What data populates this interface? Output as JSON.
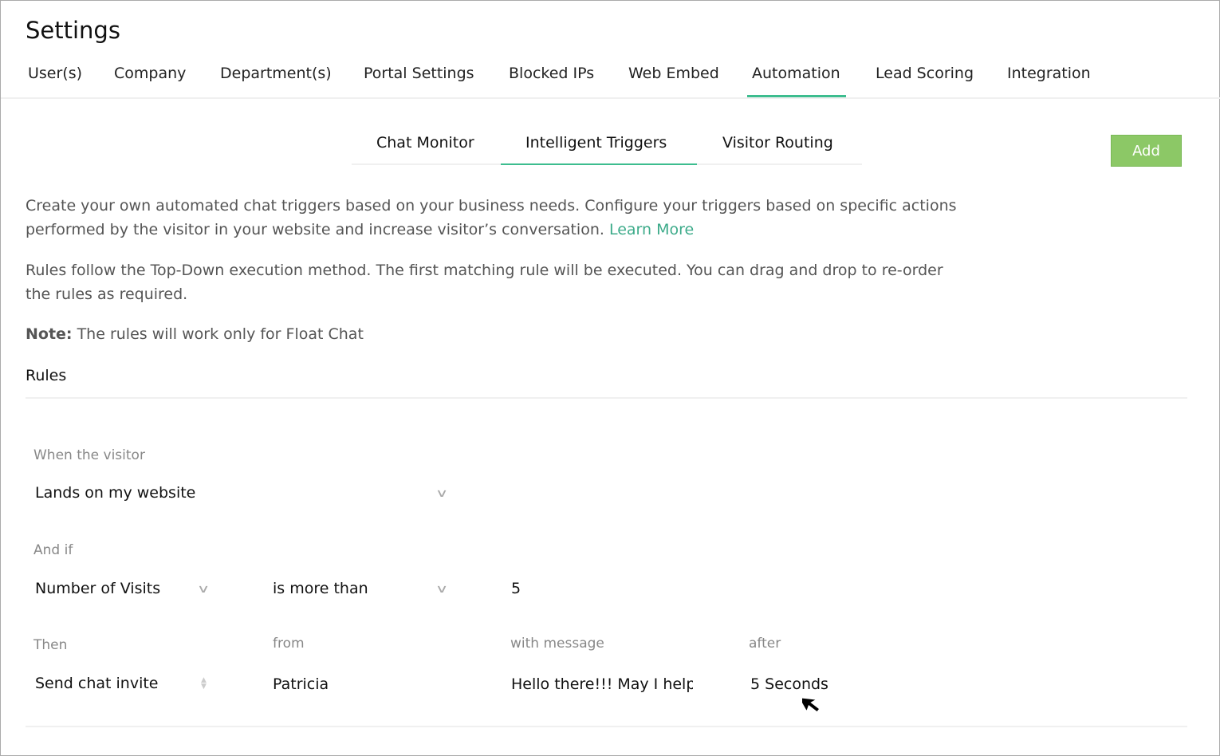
{
  "header": {
    "title": "Settings"
  },
  "main_tabs": [
    {
      "label": "User(s)"
    },
    {
      "label": "Company"
    },
    {
      "label": "Department(s)"
    },
    {
      "label": "Portal Settings"
    },
    {
      "label": "Blocked IPs"
    },
    {
      "label": "Web Embed"
    },
    {
      "label": "Automation",
      "active": true
    },
    {
      "label": "Lead Scoring"
    },
    {
      "label": "Integration"
    }
  ],
  "sub_tabs": [
    {
      "label": "Chat Monitor"
    },
    {
      "label": "Intelligent Triggers",
      "active": true
    },
    {
      "label": "Visitor Routing"
    }
  ],
  "add_label": "Add",
  "description": {
    "line1": "Create your own automated chat triggers based on your business needs. Configure your triggers based on specific actions performed by the visitor in your website and increase visitor’s conversation.",
    "learn_more": "Learn More",
    "rules_info": "Rules follow the Top-Down execution method. The first matching rule will be executed. You can drag and drop to re-order the rules as required.",
    "note_label": "Note:",
    "note_text": " The rules will work only for Float Chat"
  },
  "rules_title": "Rules",
  "rule": {
    "when_label": "When the visitor",
    "when_value": "Lands on my website",
    "andif_label": "And if",
    "condition_field": "Number of Visits",
    "condition_operator": "is more than",
    "condition_value": "5",
    "then_label": "Then",
    "then_value": "Send chat invite",
    "from_label": "from",
    "from_value": "Patricia",
    "message_label": "with message",
    "message_value": "Hello there!!! May I help",
    "after_label": "after",
    "after_value": "5 Seconds"
  },
  "colors": {
    "accent": "#3dbd8f",
    "add_button": "#8cc866"
  }
}
